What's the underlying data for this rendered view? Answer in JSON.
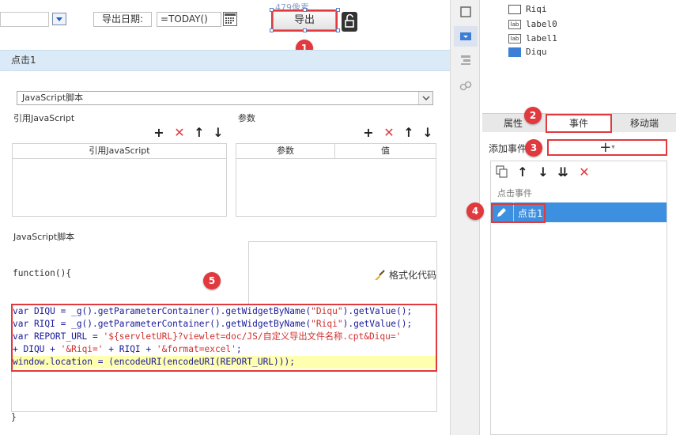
{
  "toolbar": {
    "date_label": "导出日期:",
    "date_value": "=TODAY()",
    "export_label": "导出",
    "width_readout": "479像素"
  },
  "section": {
    "title": "点击1"
  },
  "editor": {
    "type_select": "JavaScript脚本",
    "ref_js_title": "引用JavaScript",
    "ref_js_column": "引用JavaScript",
    "params_title": "参数",
    "params_col_name": "参数",
    "params_col_value": "值",
    "script_title": "JavaScript脚本",
    "format_code": "格式化代码",
    "func_open": "function(){",
    "func_close": "}",
    "code": {
      "l1a": "var DIQU = _g().getParameterContainer().getWidgetByName(",
      "l1s": "\"Diqu\"",
      "l1b": ").getValue();",
      "l2a": "var RIQI = _g().getParameterContainer().getWidgetByName(",
      "l2s": "\"Riqi\"",
      "l2b": ").getValue();",
      "l3a": "var REPORT_URL = ",
      "l3s": "'${servletURL}?viewlet=doc/JS/自定义导出文件名称.cpt&Diqu='",
      "l4a": "+ DIQU + ",
      "l4s1": "'&Riqi='",
      "l4b": " + RIQI + ",
      "l4s2": "'&format=excel'",
      "l4c": ";",
      "l5": "window.location = (encodeURI(encodeURI(REPORT_URL)));"
    }
  },
  "widget_tree": {
    "items": [
      {
        "label": "Riqi",
        "icon": "calendar-icon"
      },
      {
        "label": "label0",
        "icon": "lab"
      },
      {
        "label": "label1",
        "icon": "lab"
      },
      {
        "label": "Diqu",
        "icon": "combo-icon"
      }
    ]
  },
  "right_panel": {
    "tab_props": "属性",
    "tab_events": "事件",
    "tab_mobile": "移动端",
    "add_event_label": "添加事件",
    "event_group": "点击事件",
    "event_item": "点击1"
  },
  "badges": [
    "1",
    "2",
    "3",
    "4",
    "5"
  ],
  "colors": {
    "accent_red": "#e0393e",
    "selection_blue": "#3d8fe0",
    "section_bar": "#dbeaf7",
    "code_string": "#d12f2f",
    "code_text": "#1a1a9b"
  }
}
